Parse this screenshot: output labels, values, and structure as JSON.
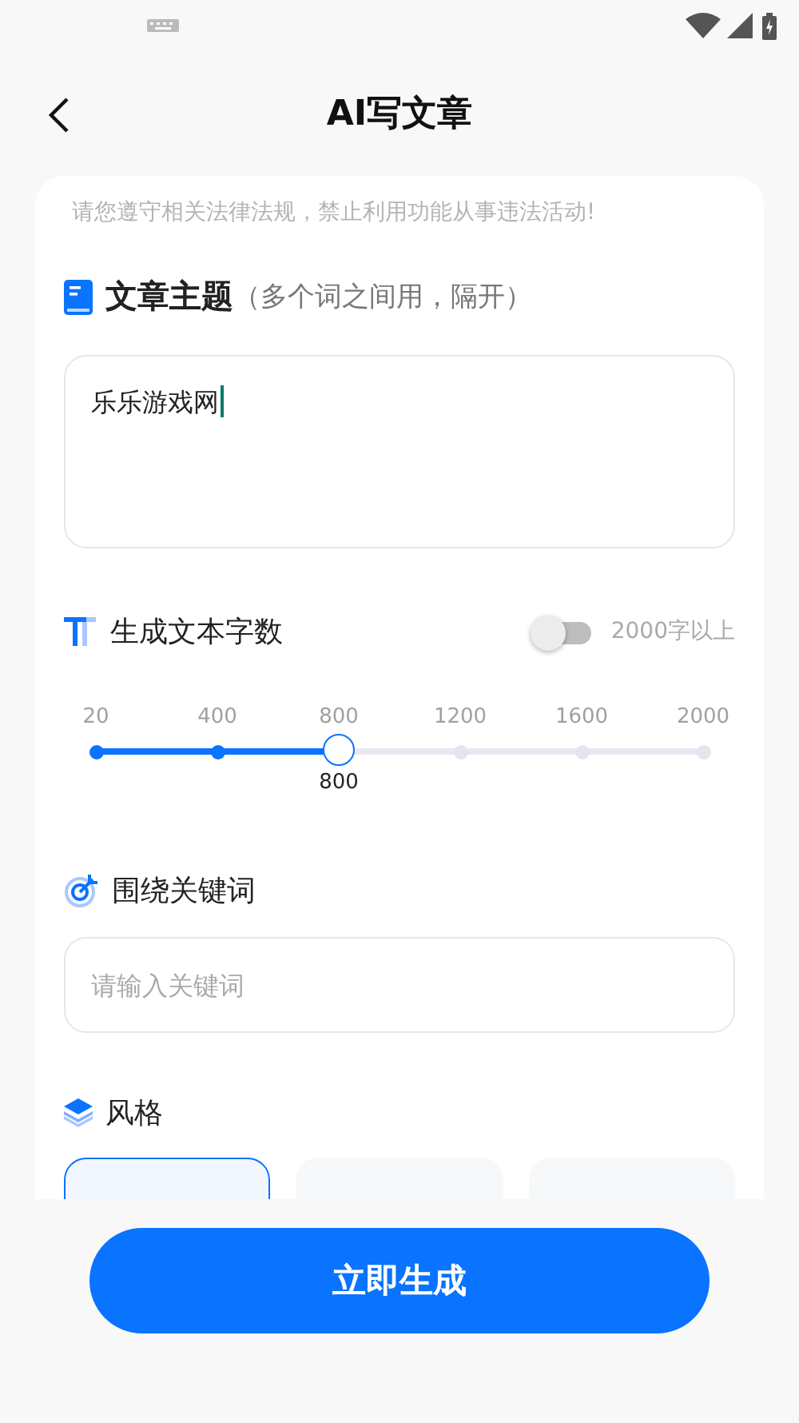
{
  "header": {
    "title": "AI写文章"
  },
  "notice": "请您遵守相关法律法规，禁止利用功能从事违法活动!",
  "topic": {
    "label": "文章主题",
    "hint": "（多个词之间用，隔开）",
    "value": "乐乐游戏网",
    "focused": true
  },
  "length": {
    "label": "生成文本字数",
    "over_toggle": {
      "label": "2000字以上",
      "on": false
    },
    "slider": {
      "ticks": [
        "20",
        "400",
        "800",
        "1200",
        "1600",
        "2000"
      ],
      "level": 0.4,
      "reading": "800"
    }
  },
  "keywords": {
    "label": "围绕关键词",
    "placeholder": "请输入关键词"
  },
  "style": {
    "label": "风格",
    "options": [
      {
        "selected": true
      },
      {
        "selected": false
      },
      {
        "selected": false
      }
    ]
  },
  "submit": {
    "label": "立即生成"
  }
}
